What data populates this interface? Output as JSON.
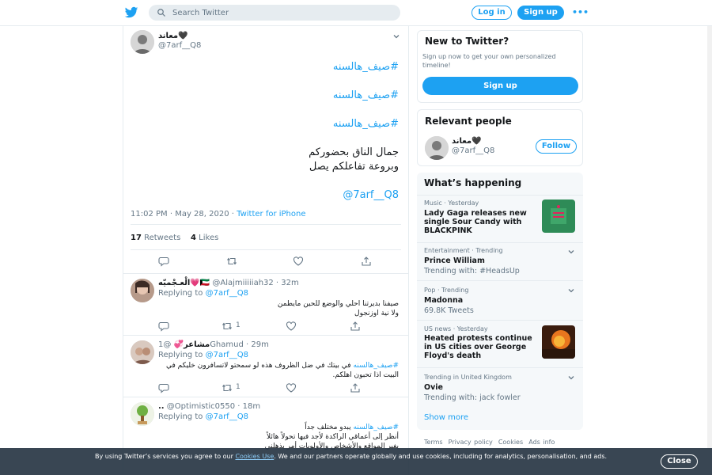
{
  "header": {
    "search_placeholder": "Search Twitter",
    "login": "Log in",
    "signup": "Sign up",
    "more": "•••"
  },
  "tweet": {
    "name": "معاند🖤",
    "handle": "@7arf__Q8",
    "hashtags": [
      "#صيف_هالسنه",
      "#صيف_هالسنه",
      "#صيف_هالسنه"
    ],
    "body": [
      "جمال الناق بحضوركم",
      "وبروعة تفاعلكم يصل"
    ],
    "mention": "@7arf__Q8",
    "time": "11:02 PM · May 28, 2020 ·",
    "source": "Twitter for iPhone",
    "retweets_count": "17",
    "retweets_label": "Retweets",
    "likes_count": "4",
    "likes_label": "Likes"
  },
  "replies": [
    {
      "name": "الْعـجْميّه💗🇰🇼",
      "meta": "@Alajmiiiiiah32 · 32m",
      "replying": "Replying to",
      "to": "@7arf__Q8",
      "lines": [
        "صيفنا بديرتنا احلي والوضع للحين مايطمن",
        "ولا نية اوزنجول"
      ],
      "retweets": "1"
    },
    {
      "name": "مشاعر💞",
      "meta": "@1Ghamud · 29m",
      "replying": "Replying to",
      "to": "@7arf__Q8",
      "tag": "#صيف_هالسنه",
      "lines": [
        "في بيتك في ضل الظروف هذه لو سمحتو لاتسافرون خليكم في",
        "البيت اذا تحبون اهلكم."
      ],
      "retweets": "1"
    },
    {
      "name": "..",
      "meta": "@Optimistic0550 · 18m",
      "replying": "Replying to",
      "to": "@7arf__Q8",
      "tag": "#صيف_هالسنه",
      "lines": [
        "يبدو مختلف جداً",
        "أنظر إلى أعماقي الراكدة لأجد فيها تحولاً هائلاً",
        "يغير المواقع والأشخاص والأولويات أمر يذهلني"
      ]
    }
  ],
  "sidebar": {
    "new_title": "New to Twitter?",
    "new_desc": "Sign up now to get your own personalized timeline!",
    "new_signup": "Sign up",
    "relevant_title": "Relevant people",
    "relevant_name": "معاند🖤",
    "relevant_handle": "@7arf__Q8",
    "follow": "Follow",
    "happening_title": "What’s happening",
    "trends": [
      {
        "ctx": "Music · Yesterday",
        "title": "Lady Gaga releases new single Sour Candy with BLACKPINK"
      },
      {
        "ctx": "Entertainment · Trending",
        "title": "Prince William",
        "sub": "Trending with: #HeadsUp"
      },
      {
        "ctx": "Pop · Trending",
        "title": "Madonna",
        "sub": "69.8K Tweets"
      },
      {
        "ctx": "US news · Yesterday",
        "title": "Heated protests continue in US cities over George Floyd's death"
      },
      {
        "ctx": "Trending in United Kingdom",
        "title": "Ovie",
        "sub": "Trending with: jack fowler"
      }
    ],
    "show_more": "Show more",
    "footer": [
      "Terms",
      "Privacy policy",
      "Cookies",
      "Ads info"
    ]
  },
  "cookie": {
    "text_a": "By using Twitter’s services you agree to our",
    "link": "Cookies Use",
    "text_b": ". We and our partners operate globally and use cookies, including for analytics, personalisation, and ads.",
    "close": "Close"
  },
  "colors": {
    "brand": "#1da1f2",
    "text": "#14171a",
    "muted": "#657786",
    "border": "#e6ecf0"
  }
}
